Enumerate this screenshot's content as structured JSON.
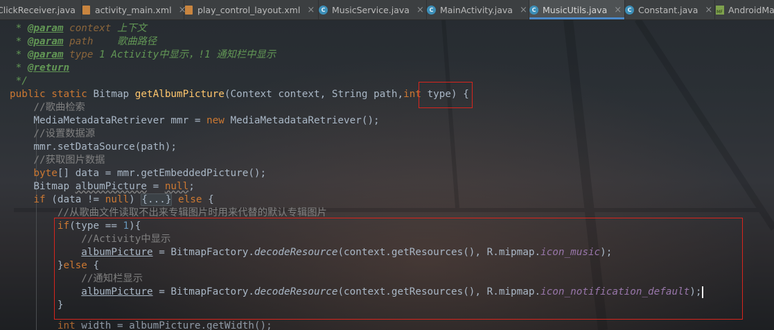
{
  "tabs": [
    {
      "label": "ClickReceiver.java",
      "icon": "java-class-icon",
      "active": false
    },
    {
      "label": "activity_main.xml",
      "icon": "xml-file-icon",
      "active": false
    },
    {
      "label": "play_control_layout.xml",
      "icon": "xml-file-icon",
      "active": false
    },
    {
      "label": "MusicService.java",
      "icon": "java-class-icon",
      "active": false
    },
    {
      "label": "MainActivity.java",
      "icon": "java-class-icon",
      "active": false
    },
    {
      "label": "MusicUtils.java",
      "icon": "java-class-icon",
      "active": true
    },
    {
      "label": "Constant.java",
      "icon": "java-class-icon",
      "active": false
    },
    {
      "label": "AndroidManife",
      "icon": "manifest-file-icon",
      "active": false
    }
  ],
  "tab_close_glyph": "×",
  "java_icon_glyph": "C",
  "manifest_icon_glyph": "MF",
  "code": {
    "l1": {
      "prefix": " * ",
      "tag": "@param",
      "name": "context",
      "desc": " 上下文"
    },
    "l2": {
      "prefix": " * ",
      "tag": "@param",
      "name": "path",
      "desc": "    歌曲路径"
    },
    "l3": {
      "prefix": " * ",
      "tag": "@param",
      "name": "type",
      "desc": " 1 Activity中显示，!1 通知栏中显示"
    },
    "l4": {
      "prefix": " * ",
      "tag": "@return"
    },
    "l5": " */",
    "l6": {
      "kw1": "public static ",
      "type": "Bitmap ",
      "fn": "getAlbumPicture",
      "params": "(Context context, String path,",
      "kw2": "int",
      "rest": " type) {"
    },
    "l7": "    //歌曲检索",
    "l8": {
      "a": "    MediaMetadataRetriever mmr = ",
      "kw": "new",
      "b": " MediaMetadataRetriever();"
    },
    "l9": "    //设置数据源",
    "l10": "    mmr.setDataSource(path);",
    "l11": "    //获取图片数据",
    "l12": {
      "kw": "    byte",
      "rest": "[] data = mmr.getEmbeddedPicture();"
    },
    "l13": {
      "a": "    Bitmap ",
      "var": "albumPicture",
      "b": " = ",
      "kw": "null",
      "c": ";"
    },
    "l14": {
      "kw1": "    if",
      "a": " (data != ",
      "kw2": "null",
      "b": ") ",
      "fold": "{...}",
      "kw3": " else",
      "c": " {"
    },
    "l15": "        //从歌曲文件读取不出来专辑图片时用来代替的默认专辑图片",
    "l16": {
      "kw": "        if",
      "a": "(type == ",
      "num": "1",
      "b": "){"
    },
    "l17": "            //Activity中显示",
    "l18": {
      "a": "            ",
      "var": "albumPicture",
      "b": " = BitmapFactory.",
      "m": "decodeResource",
      "c": "(context.getResources(), R.mipmap.",
      "f": "icon_music",
      "d": ");"
    },
    "l19": {
      "a": "        }",
      "kw": "else",
      "b": " {"
    },
    "l20": "            //通知栏显示",
    "l21": {
      "a": "            ",
      "var": "albumPicture",
      "b": " = BitmapFactory.",
      "m": "decodeResource",
      "c": "(context.getResources(), R.mipmap.",
      "f": "icon_notification_default",
      "d": ");"
    },
    "l22": "        }",
    "l23": {
      "kw": "        int",
      "rest": " width = albumPicture.getWidth();"
    }
  },
  "colors": {
    "keyword": "#cc7832",
    "method": "#ffc66d",
    "comment": "#808080",
    "doc": "#629755",
    "number": "#6897bb",
    "field": "#9876aa",
    "text": "#a9b7c6",
    "highlight_box": "#d9251d"
  }
}
